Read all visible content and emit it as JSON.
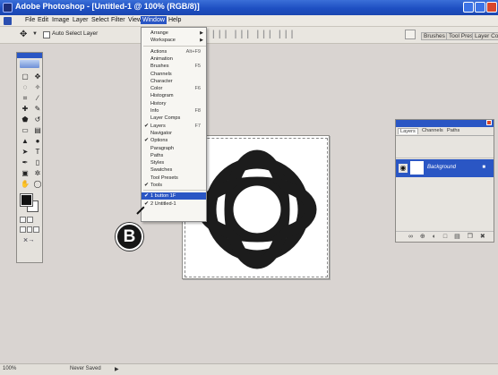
{
  "titlebar": {
    "title": "Adobe Photoshop - [Untitled-1 @ 100% (RGB/8)]"
  },
  "menubar": {
    "items": [
      "File",
      "Edit",
      "Image",
      "Layer",
      "Select",
      "Filter",
      "View",
      "Window",
      "Help"
    ],
    "active": "Window"
  },
  "options": {
    "auto_select_label": "Auto Select Layer",
    "well_tabs": [
      "Brushes",
      "Tool Presets",
      "Layer Comps"
    ]
  },
  "window_menu": {
    "items": [
      {
        "label": "Arrange",
        "shortcut": "",
        "checked": false,
        "submenu": true
      },
      {
        "label": "Workspace",
        "shortcut": "",
        "checked": false,
        "submenu": true
      },
      {
        "label": "Actions",
        "shortcut": "Alt+F9",
        "checked": false,
        "submenu": false
      },
      {
        "label": "Animation",
        "shortcut": "",
        "checked": false,
        "submenu": false
      },
      {
        "label": "Brushes",
        "shortcut": "F5",
        "checked": false,
        "submenu": false
      },
      {
        "label": "Channels",
        "shortcut": "",
        "checked": false,
        "submenu": false
      },
      {
        "label": "Character",
        "shortcut": "",
        "checked": false,
        "submenu": false
      },
      {
        "label": "Color",
        "shortcut": "F6",
        "checked": false,
        "submenu": false
      },
      {
        "label": "Histogram",
        "shortcut": "",
        "checked": false,
        "submenu": false
      },
      {
        "label": "History",
        "shortcut": "",
        "checked": false,
        "submenu": false
      },
      {
        "label": "Info",
        "shortcut": "F8",
        "checked": false,
        "submenu": false
      },
      {
        "label": "Layer Comps",
        "shortcut": "",
        "checked": false,
        "submenu": false
      },
      {
        "label": "Layers",
        "shortcut": "F7",
        "checked": true,
        "submenu": false
      },
      {
        "label": "Navigator",
        "shortcut": "",
        "checked": false,
        "submenu": false
      },
      {
        "label": "Options",
        "shortcut": "",
        "checked": true,
        "submenu": false
      },
      {
        "label": "Paragraph",
        "shortcut": "",
        "checked": false,
        "submenu": false
      },
      {
        "label": "Paths",
        "shortcut": "",
        "checked": false,
        "submenu": false
      },
      {
        "label": "Styles",
        "shortcut": "",
        "checked": false,
        "submenu": false
      },
      {
        "label": "Swatches",
        "shortcut": "",
        "checked": false,
        "submenu": false
      },
      {
        "label": "Tool Presets",
        "shortcut": "",
        "checked": false,
        "submenu": false
      },
      {
        "label": "Tools",
        "shortcut": "",
        "checked": true,
        "submenu": false
      },
      {
        "label": "1 button 1F",
        "shortcut": "",
        "checked": true,
        "submenu": false,
        "highlighted": true
      },
      {
        "label": "2 Untitled-1",
        "shortcut": "",
        "checked": true,
        "submenu": false
      }
    ]
  },
  "callout": {
    "label": "B"
  },
  "layers_panel": {
    "tabs": [
      "Layers",
      "Channels",
      "Paths"
    ],
    "layer_name": "Background"
  },
  "statusbar": {
    "zoom": "100%",
    "doc_info": "Never Saved"
  },
  "colors": {
    "accent": "#2a56c4",
    "canvas_bg": "#d9d4d1",
    "symbol": "#1c1c1c"
  }
}
